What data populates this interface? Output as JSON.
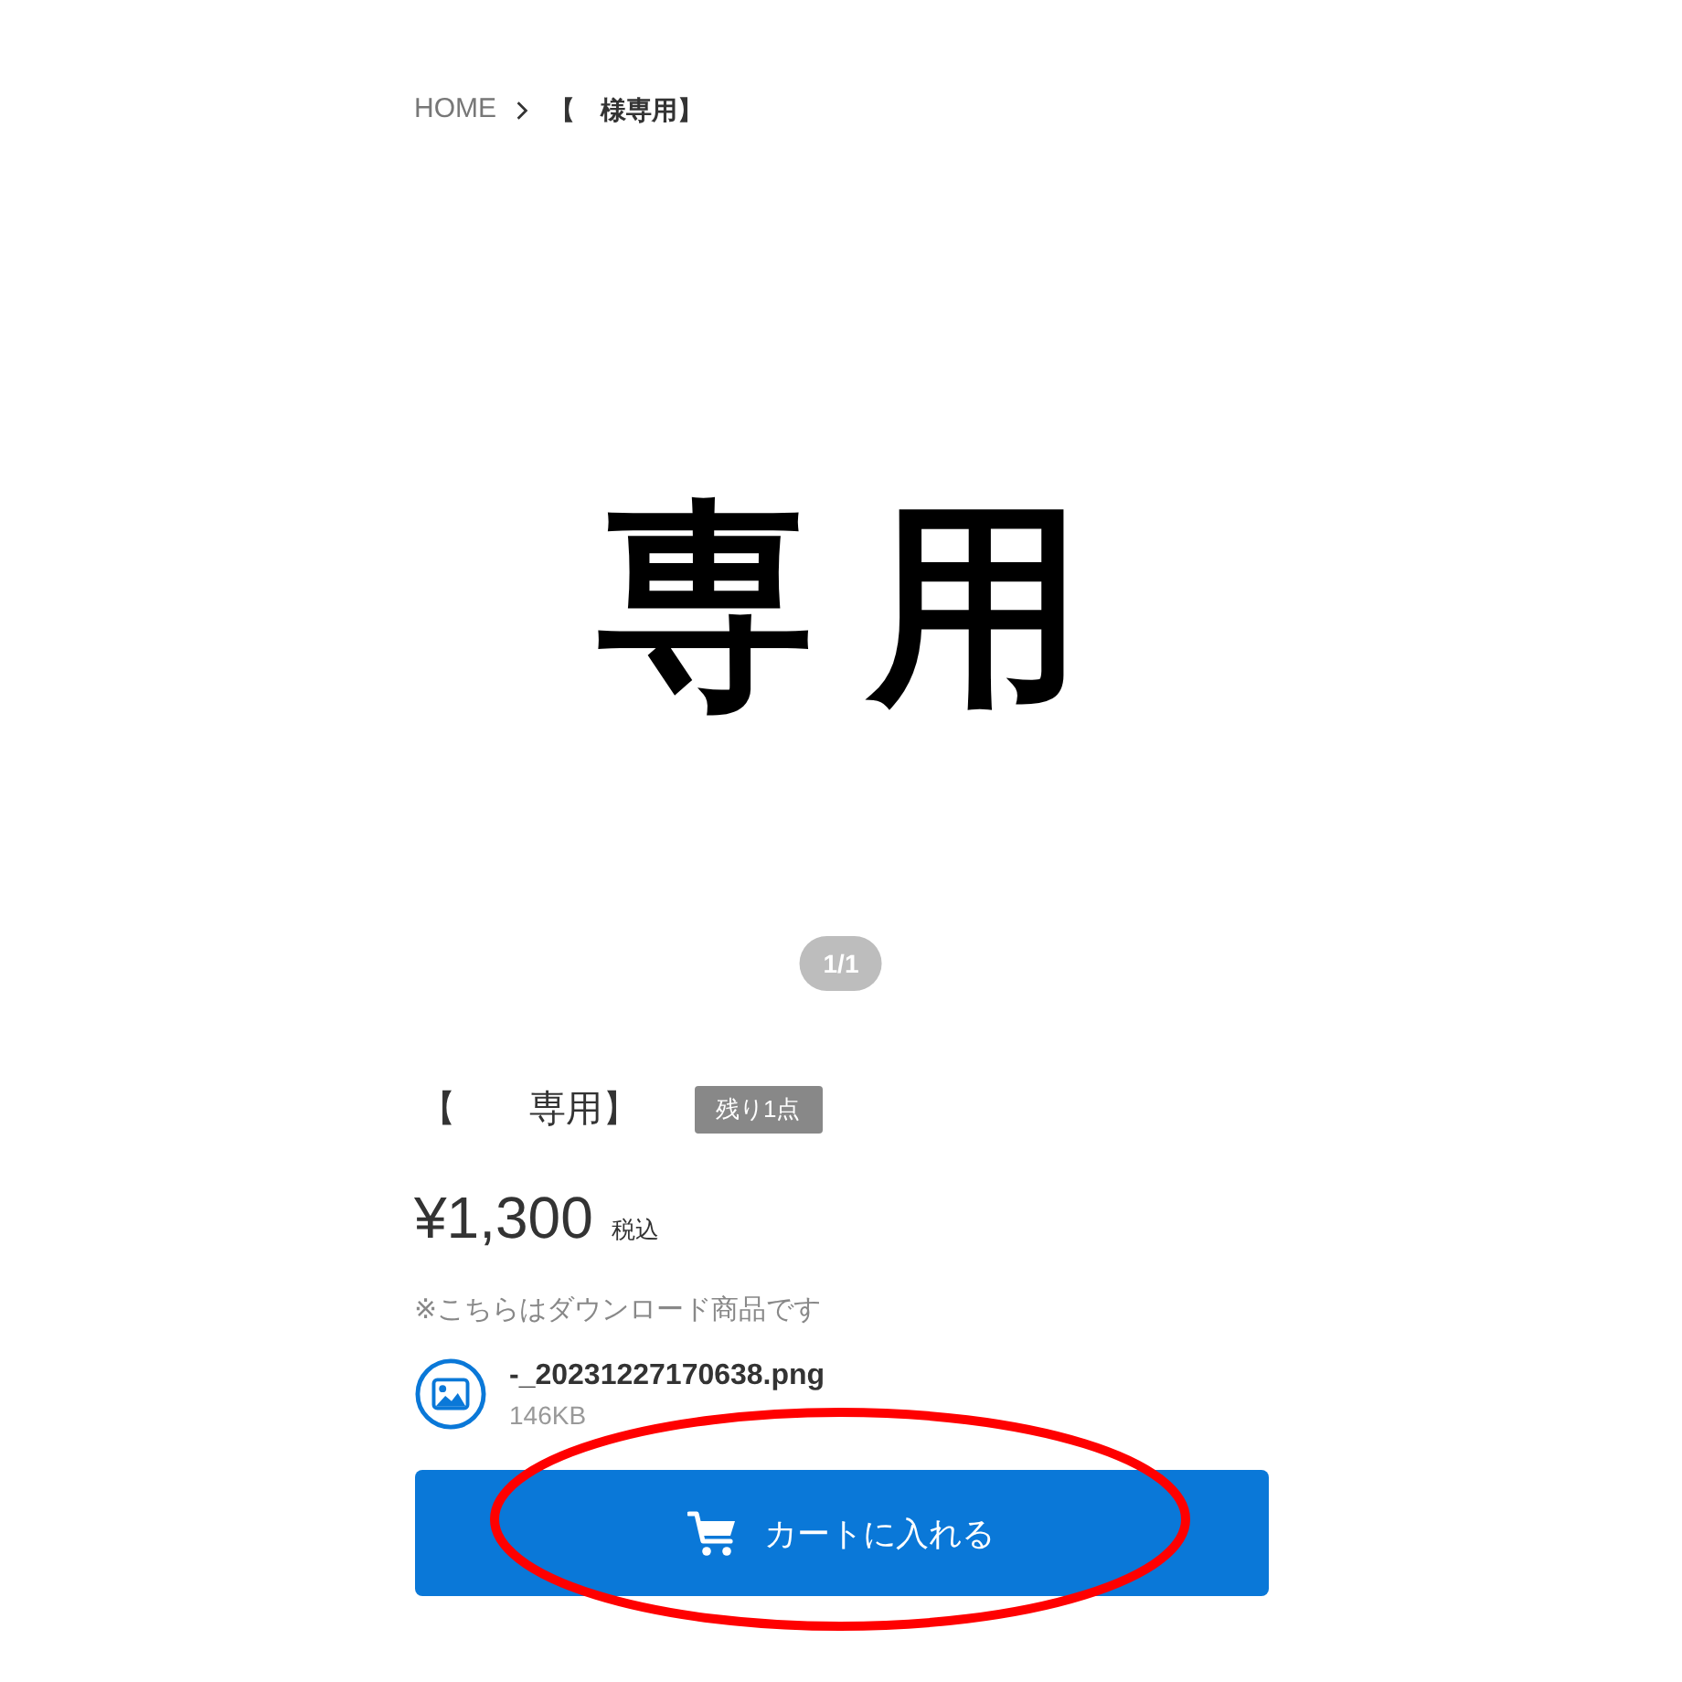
{
  "breadcrumb": [
    {
      "label": "HOME",
      "kind": "link"
    },
    {
      "label": "【　様専用】",
      "kind": "current"
    }
  ],
  "product_image": {
    "text": "専用",
    "pager": "1/1"
  },
  "product": {
    "title": "【　　専用】",
    "stock_badge": "残り1点",
    "price": "¥1,300",
    "tax_note": "税込",
    "download_note": "※こちらはダウンロード商品です"
  },
  "file": {
    "name": "-_20231227170638.png",
    "size": "146KB"
  },
  "cart_button": {
    "label": "カートに入れる"
  },
  "annotation": {
    "kind": "ellipse"
  }
}
